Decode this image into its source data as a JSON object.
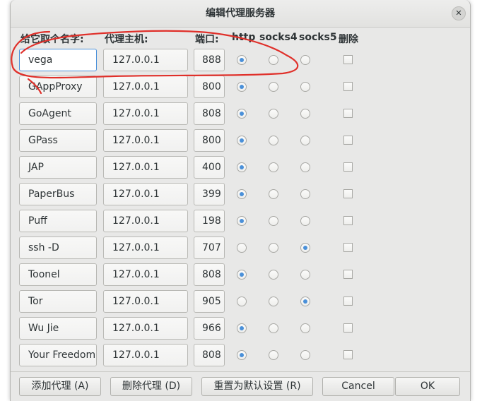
{
  "window": {
    "title": "编辑代理服务器",
    "close_glyph": "✕"
  },
  "headers": {
    "name": "给它取个名字:",
    "host": "代理主机:",
    "port": "端口:",
    "http": "http",
    "socks4": "socks4",
    "socks5": "socks5",
    "delete": "删除"
  },
  "proxies": [
    {
      "name": "vega",
      "host": "127.0.0.1",
      "port": "888",
      "type": "http",
      "delete": false,
      "focused": true
    },
    {
      "name": "GAppProxy",
      "host": "127.0.0.1",
      "port": "800",
      "type": "http",
      "delete": false
    },
    {
      "name": "GoAgent",
      "host": "127.0.0.1",
      "port": "808",
      "type": "http",
      "delete": false
    },
    {
      "name": "GPass",
      "host": "127.0.0.1",
      "port": "800",
      "type": "http",
      "delete": false
    },
    {
      "name": "JAP",
      "host": "127.0.0.1",
      "port": "400",
      "type": "http",
      "delete": false
    },
    {
      "name": "PaperBus",
      "host": "127.0.0.1",
      "port": "399",
      "type": "http",
      "delete": false
    },
    {
      "name": "Puff",
      "host": "127.0.0.1",
      "port": "198",
      "type": "http",
      "delete": false
    },
    {
      "name": "ssh -D",
      "host": "127.0.0.1",
      "port": "707",
      "type": "socks5",
      "delete": false
    },
    {
      "name": "Toonel",
      "host": "127.0.0.1",
      "port": "808",
      "type": "http",
      "delete": false
    },
    {
      "name": "Tor",
      "host": "127.0.0.1",
      "port": "905",
      "type": "socks5",
      "delete": false
    },
    {
      "name": "Wu Jie",
      "host": "127.0.0.1",
      "port": "966",
      "type": "http",
      "delete": false
    },
    {
      "name": "Your Freedom",
      "host": "127.0.0.1",
      "port": "808",
      "type": "http",
      "delete": false
    }
  ],
  "buttons": {
    "add": "添加代理 (A)",
    "remove": "删除代理 (D)",
    "reset": "重置为默认设置 (R)",
    "cancel": "Cancel",
    "ok": "OK"
  },
  "colors": {
    "accent": "#4a90d9",
    "annotation": "#e0302a",
    "dialog_bg": "#e8e8e7"
  }
}
